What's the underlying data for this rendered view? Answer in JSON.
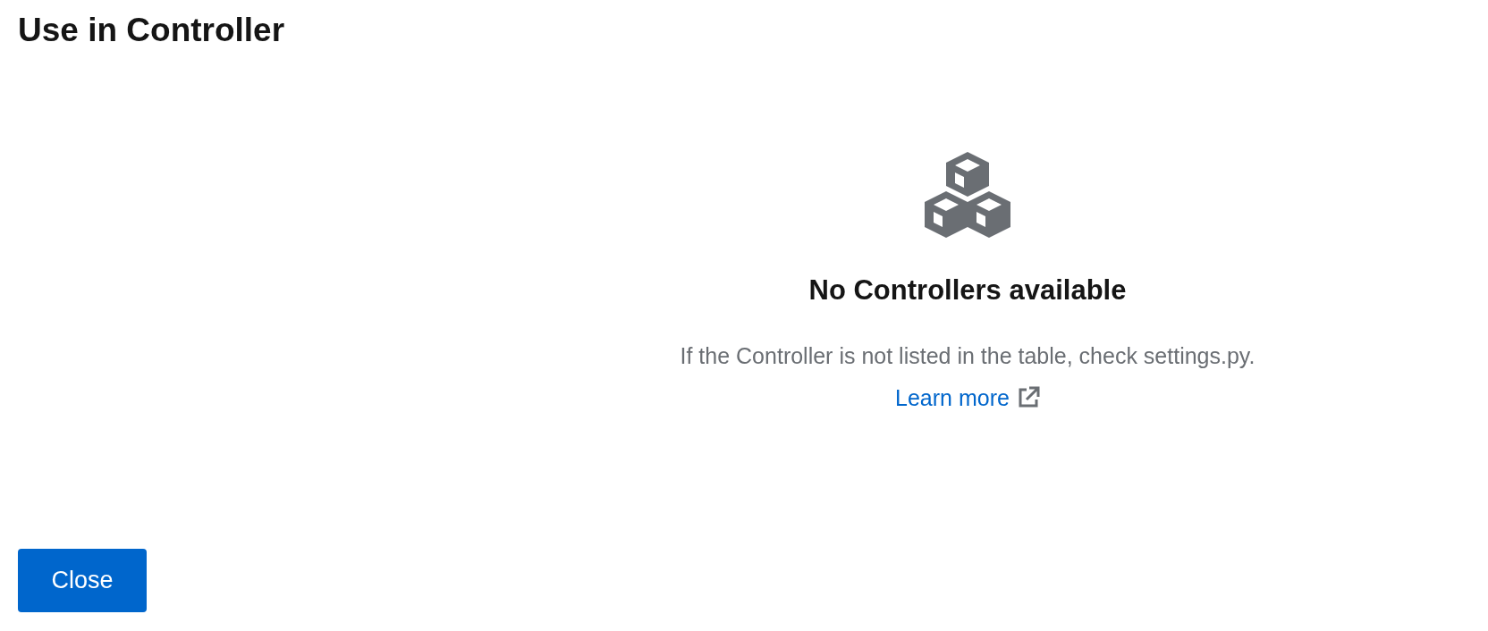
{
  "title": "Use in Controller",
  "empty_state": {
    "heading": "No Controllers available",
    "body": "If the Controller is not listed in the table, check settings.py.",
    "link": "Learn more"
  },
  "buttons": [
    {
      "label": "Close",
      "kind": "primary"
    }
  ]
}
